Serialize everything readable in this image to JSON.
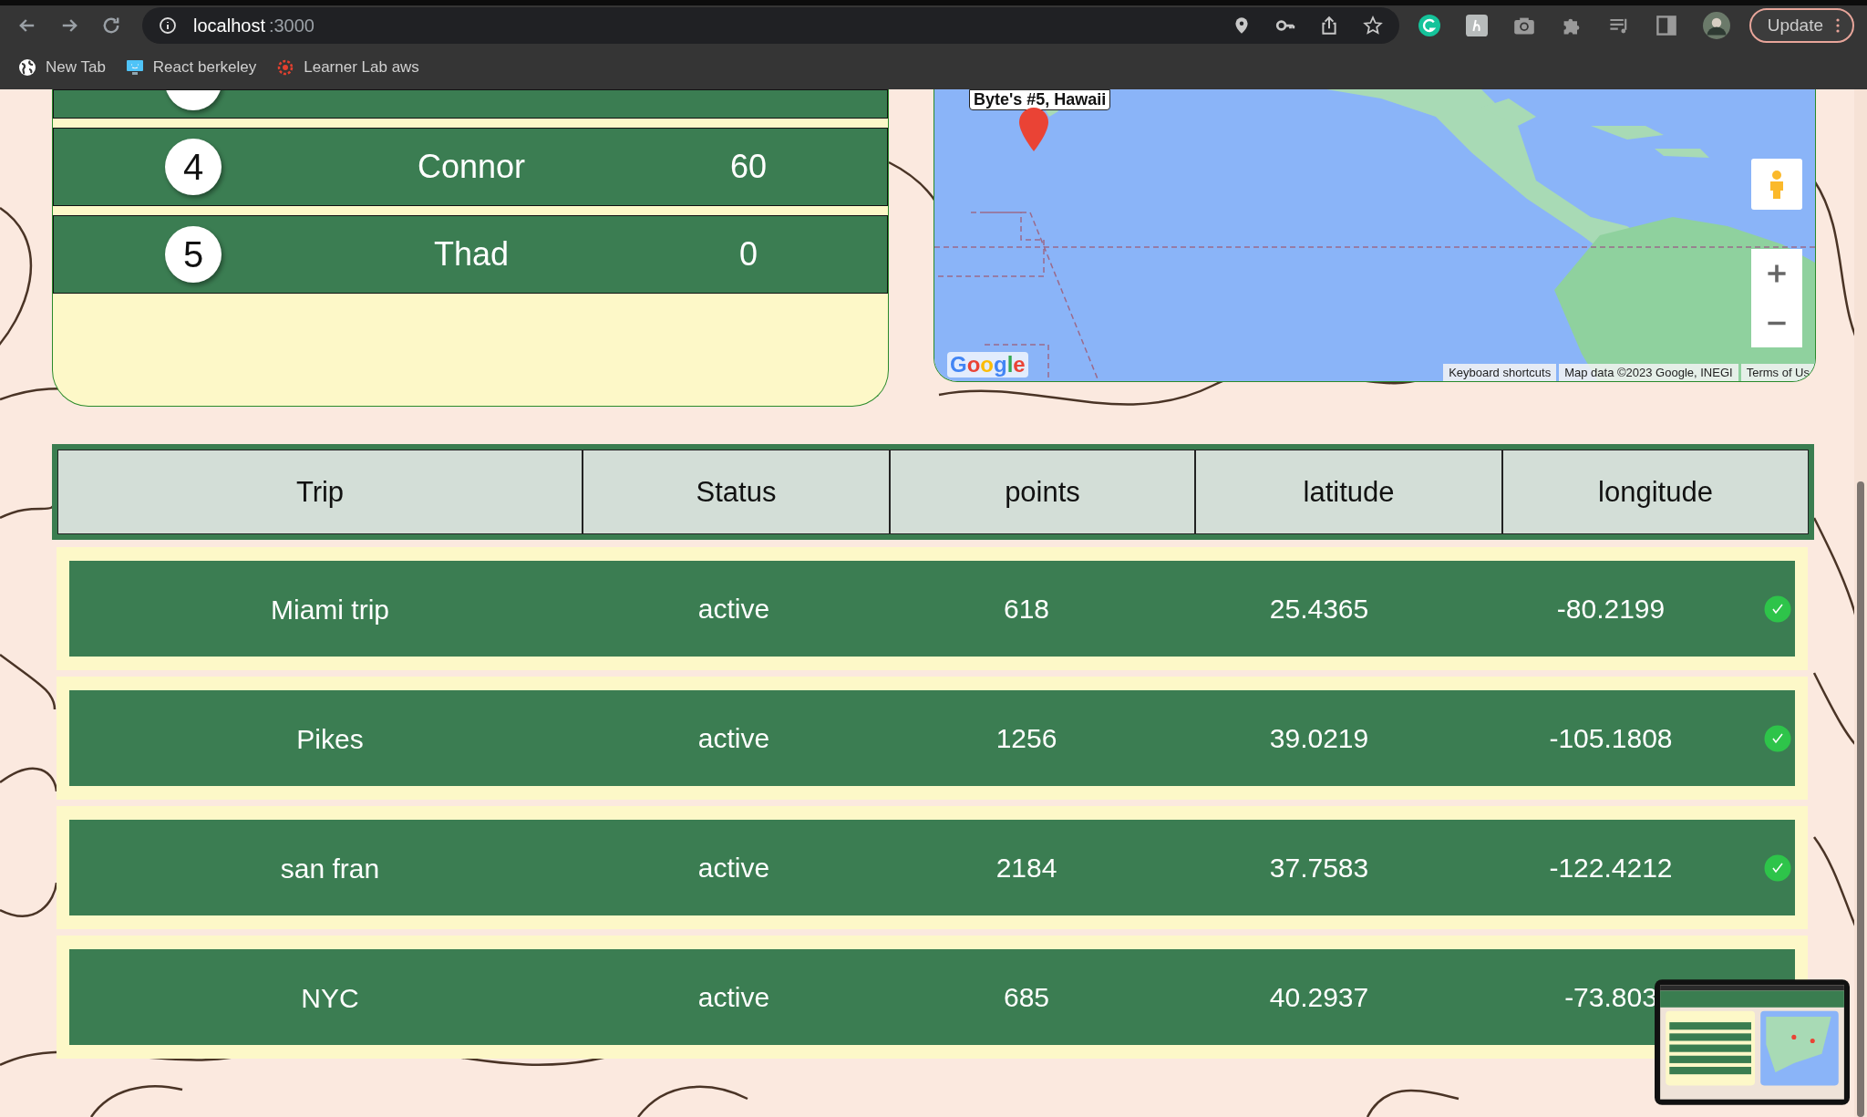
{
  "browser": {
    "url_host": "localhost",
    "url_port": ":3000",
    "bookmarks": [
      {
        "label": "New Tab"
      },
      {
        "label": "React berkeley"
      },
      {
        "label": "Learner Lab aws"
      }
    ],
    "update_button": "Update"
  },
  "leaderboard": {
    "rows": [
      {
        "rank": "4",
        "user": "Connor",
        "points": "60"
      },
      {
        "rank": "5",
        "user": "Thad",
        "points": "0"
      }
    ]
  },
  "map": {
    "marker_label": "Byte's #5, Hawaii",
    "logo": "Google",
    "attribution": [
      "Keyboard shortcuts",
      "Map data ©2023 Google, INEGI",
      "Terms of Us"
    ]
  },
  "trips": {
    "columns": [
      "Trip",
      "Status",
      "points",
      "latitude",
      "longitude"
    ],
    "rows": [
      {
        "trip": "Miami trip",
        "status": "active",
        "points": "618",
        "latitude": "25.4365",
        "longitude": "-80.2199",
        "checked": true
      },
      {
        "trip": "Pikes",
        "status": "active",
        "points": "1256",
        "latitude": "39.0219",
        "longitude": "-105.1808",
        "checked": true
      },
      {
        "trip": "san fran",
        "status": "active",
        "points": "2184",
        "latitude": "37.7583",
        "longitude": "-122.4212",
        "checked": true
      },
      {
        "trip": "NYC",
        "status": "active",
        "points": "685",
        "latitude": "40.2937",
        "longitude": "-73.803"
      }
    ]
  }
}
